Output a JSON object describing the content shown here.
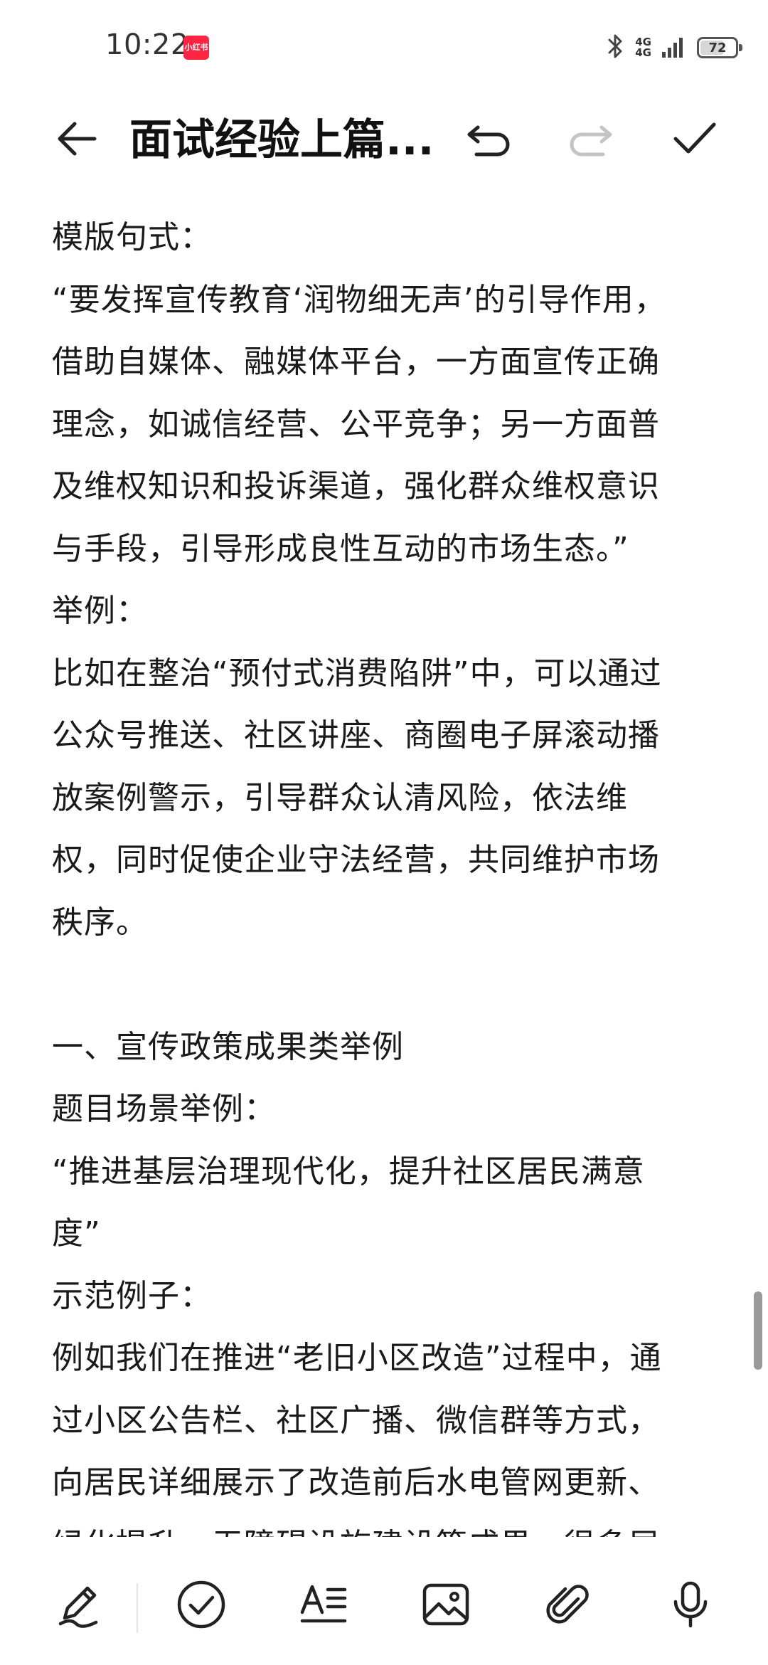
{
  "status_bar": {
    "time": "10:22",
    "notification_app_label": "小红书",
    "network_top": "4G",
    "network_bottom": "4G",
    "battery_level": "72"
  },
  "toolbar": {
    "title": "面试经验上篇..."
  },
  "content": {
    "paragraphs": [
      "模版句式：",
      "“要发挥宣传教育‘润物细无声’的引导作用，",
      "借助自媒体、融媒体平台，一方面宣传正确",
      "理念，如诚信经营、公平竞争；另一方面普",
      "及维权知识和投诉渠道，强化群众维权意识",
      "与手段，引导形成良性互动的市场生态。”",
      "举例：",
      "比如在整治“预付式消费陷阱”中，可以通过",
      "公众号推送、社区讲座、商圈电子屏滚动播",
      "放案例警示，引导群众认清风险，依法维",
      "权，同时促使企业守法经营，共同维护市场",
      "秩序。",
      "",
      "一、宣传政策成果类举例",
      "题目场景举例：",
      "“推进基层治理现代化，提升社区居民满意",
      "度”",
      "示范例子：",
      "例如我们在推进“老旧小区改造”过程中，通",
      "过小区公告栏、社区广播、微信群等方式，",
      "向居民详细展示了改造前后水电管网更新、",
      "绿化提升、无障碍设施建设等成果，很多居"
    ]
  },
  "colors": {
    "badge": "#ff2442",
    "text": "#1a1a1a",
    "redo_disabled": "#c4c4c4"
  }
}
